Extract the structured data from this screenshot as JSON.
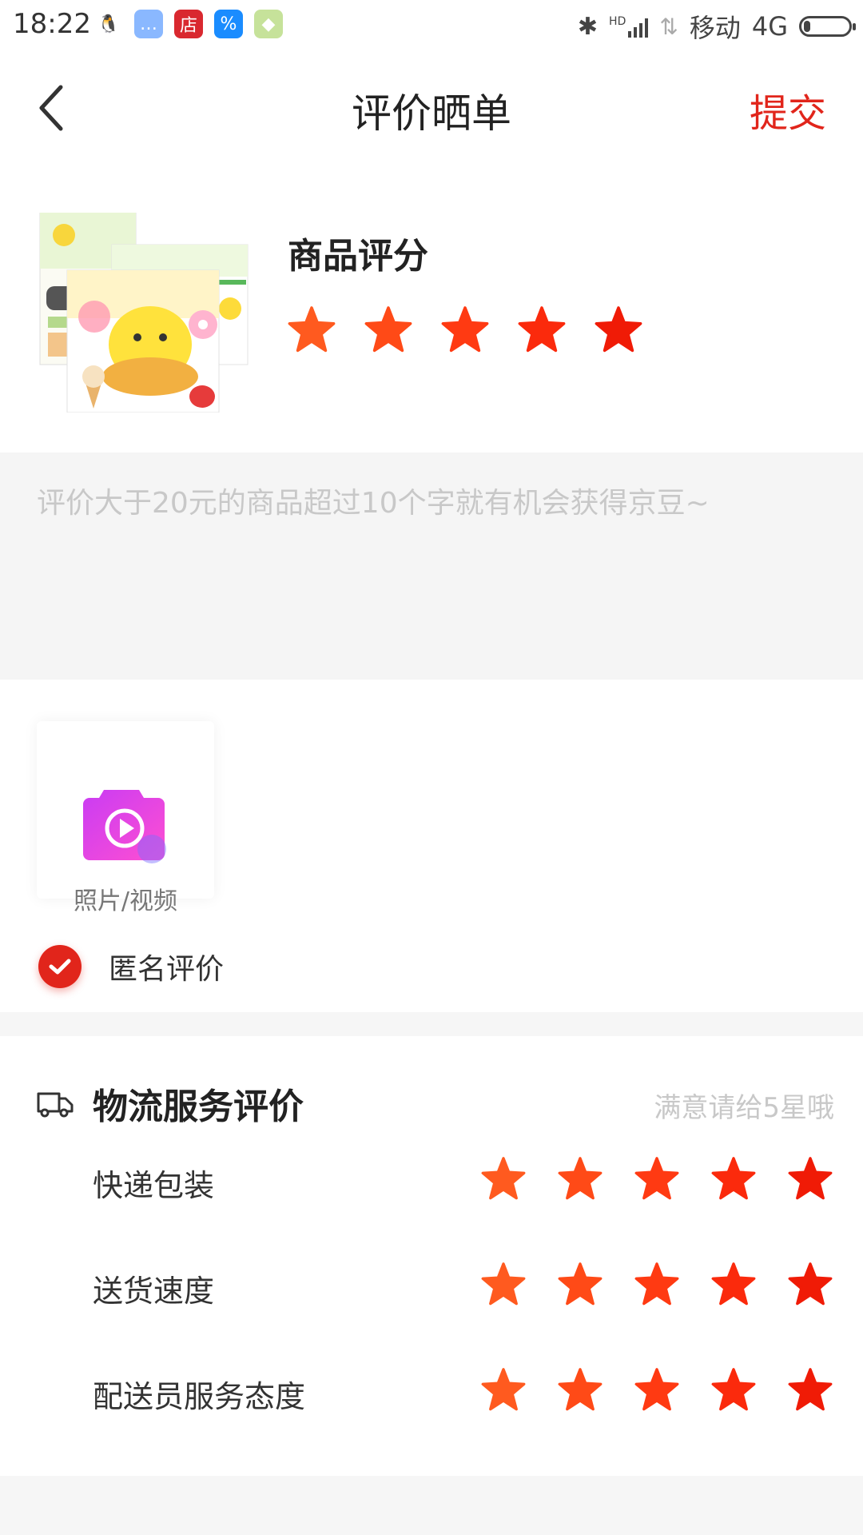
{
  "status_bar": {
    "time": "18:22",
    "carrier": "移动",
    "network": "4G",
    "hd_label": "HD",
    "battery_level": 0.15,
    "apps": [
      {
        "name": "qq-icon",
        "glyph": "🐧",
        "color": "#ffffff"
      },
      {
        "name": "chat-bubble-icon",
        "glyph": "…",
        "color": "#8ab8ff"
      },
      {
        "name": "store-icon",
        "glyph": "店",
        "color": "#d9282f"
      },
      {
        "name": "app-logo-icon",
        "glyph": "%",
        "color": "#1a8cff"
      },
      {
        "name": "map-icon",
        "glyph": "◆",
        "color": "#c6e29a"
      }
    ]
  },
  "header": {
    "title": "评价晒单",
    "submit_label": "提交"
  },
  "product": {
    "rating_label": "商品评分",
    "rating": 5,
    "star_colors": [
      "#ff5a1f",
      "#ff4a17",
      "#ff3a12",
      "#fb2a0c",
      "#f01b06"
    ]
  },
  "comment": {
    "placeholder": "评价大于20元的商品超过10个字就有机会获得京豆~",
    "value": ""
  },
  "media": {
    "upload_label": "照片/视频"
  },
  "anonymous": {
    "label": "匿名评价",
    "checked": true
  },
  "logistics": {
    "title": "物流服务评价",
    "hint": "满意请给5星哦",
    "rows": [
      {
        "label": "快递包装",
        "rating": 5
      },
      {
        "label": "送货速度",
        "rating": 5
      },
      {
        "label": "配送员服务态度",
        "rating": 5
      }
    ]
  },
  "colors": {
    "accent": "#e1251b",
    "background": "#f6f6f6"
  }
}
